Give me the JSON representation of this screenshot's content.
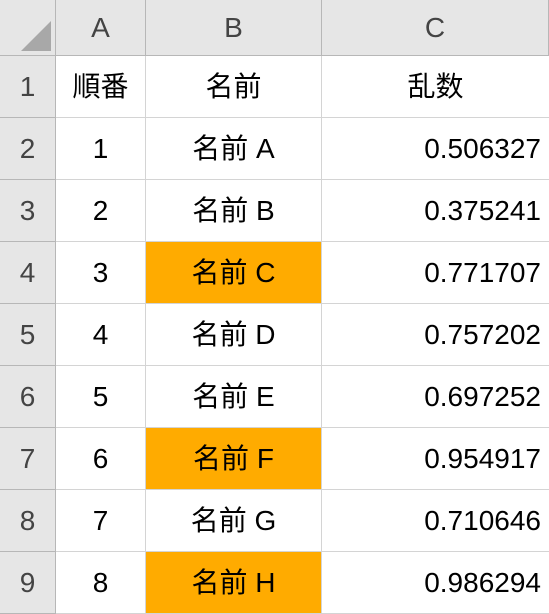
{
  "columns": [
    "A",
    "B",
    "C"
  ],
  "row_numbers": [
    1,
    2,
    3,
    4,
    5,
    6,
    7,
    8,
    9
  ],
  "headers": {
    "A": "順番",
    "B": "名前",
    "C": "乱数"
  },
  "rows": [
    {
      "order": 1,
      "name": "名前 A",
      "rand": "0.506327",
      "highlight": false
    },
    {
      "order": 2,
      "name": "名前 B",
      "rand": "0.375241",
      "highlight": false
    },
    {
      "order": 3,
      "name": "名前 C",
      "rand": "0.771707",
      "highlight": true
    },
    {
      "order": 4,
      "name": "名前 D",
      "rand": "0.757202",
      "highlight": false
    },
    {
      "order": 5,
      "name": "名前 E",
      "rand": "0.697252",
      "highlight": false
    },
    {
      "order": 6,
      "name": "名前 F",
      "rand": "0.954917",
      "highlight": true
    },
    {
      "order": 7,
      "name": "名前 G",
      "rand": "0.710646",
      "highlight": false
    },
    {
      "order": 8,
      "name": "名前 H",
      "rand": "0.986294",
      "highlight": true
    }
  ],
  "colors": {
    "highlight": "#ffab00"
  }
}
